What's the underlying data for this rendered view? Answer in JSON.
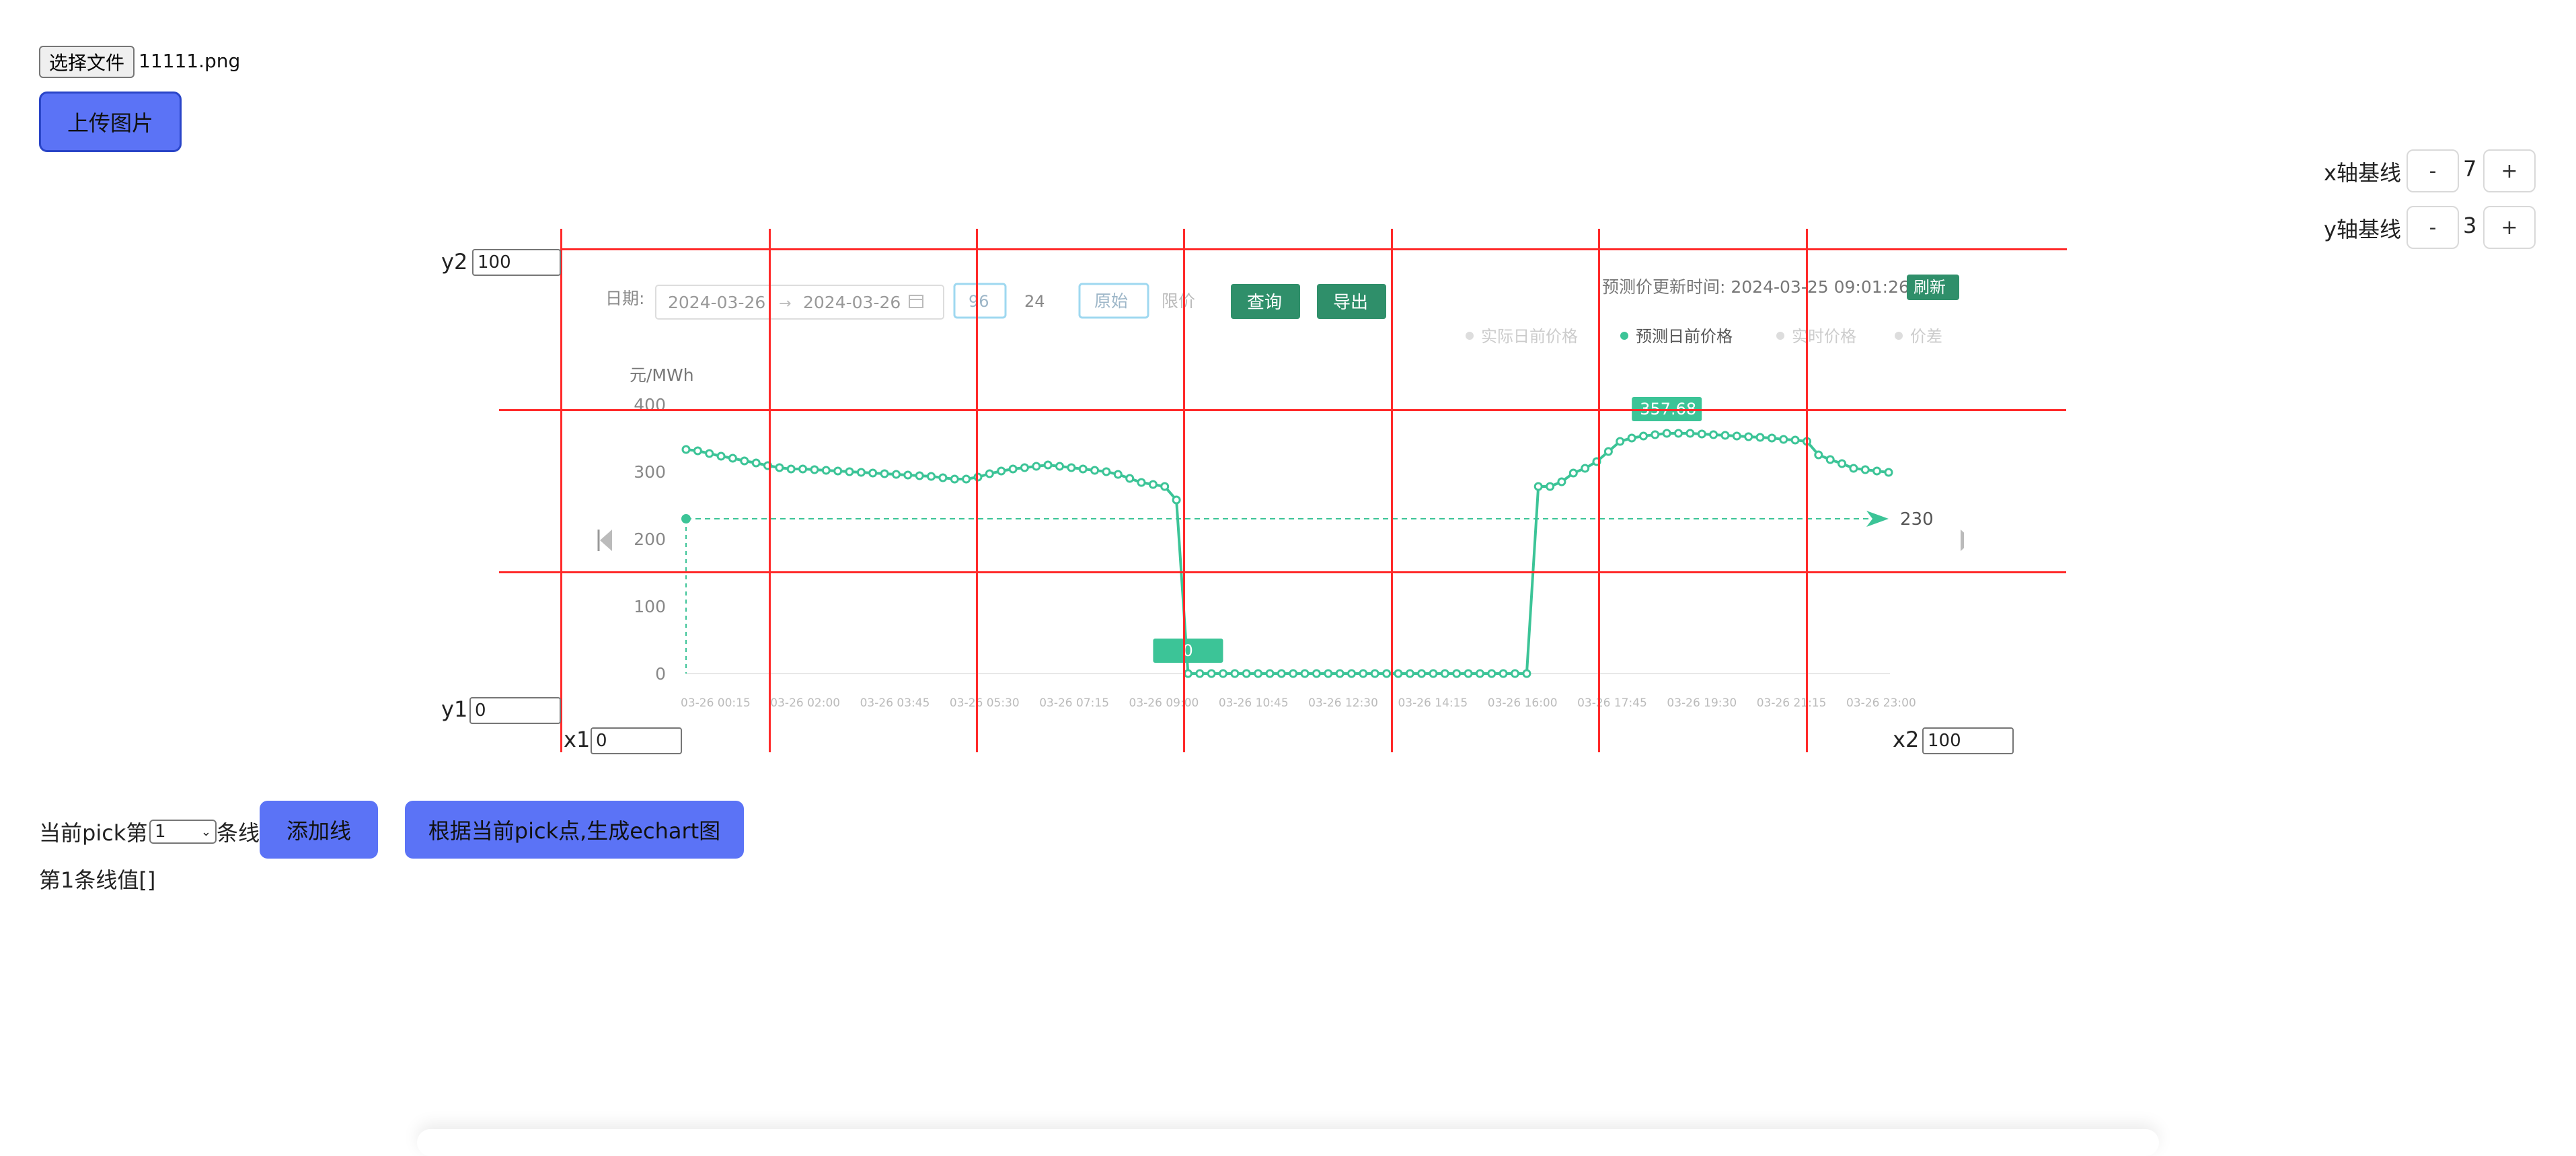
{
  "file_input": {
    "button_label": "选择文件",
    "file_name": "11111.png"
  },
  "upload_button": "上传图片",
  "baseline_controls": {
    "x": {
      "label": "x轴基线",
      "value": "7",
      "minus": "-",
      "plus": "+"
    },
    "y": {
      "label": "y轴基线",
      "value": "3",
      "minus": "-",
      "plus": "+"
    }
  },
  "calibration": {
    "y2_label": "y2",
    "y2_value": "100",
    "y1_label": "y1",
    "y1_value": "0",
    "x1_label": "x1",
    "x1_value": "0",
    "x2_label": "x2",
    "x2_value": "100"
  },
  "pick_controls": {
    "prefix": "当前pick第",
    "selected": "1",
    "suffix": "条线",
    "add_line_button": "添加线",
    "generate_button": "根据当前pick点,生成echart图",
    "line_values_text": "第1条线值[]"
  },
  "screenshot": {
    "date_label": "日期:",
    "date_start": "2024-03-26",
    "date_sep": "→",
    "date_end": "2024-03-26",
    "opt_96": "96",
    "opt_24": "24",
    "opt_original": "原始",
    "opt_limit": "限价",
    "query_button": "查询",
    "export_button": "导出",
    "update_time": "预测价更新时间: 2024-03-25 09:01:26",
    "refresh_button": "刷新",
    "legend": [
      "实际日前价格",
      "预测日前价格",
      "实时价格",
      "价差"
    ],
    "colors": {
      "series": "#3cc497",
      "dark_button": "#2f8f6a",
      "redline": "#ff2a2a",
      "blue_button": "#5b73f6"
    }
  },
  "chart_data": {
    "type": "line",
    "ylabel": "元/MWh",
    "yticks": [
      "0",
      "100",
      "200",
      "300",
      "400"
    ],
    "ylim": [
      0,
      400
    ],
    "xticks": [
      "03-26 00:15",
      "03-26 02:00",
      "03-26 03:45",
      "03-26 05:30",
      "03-26 07:15",
      "03-26 09:00",
      "03-26 10:45",
      "03-26 12:30",
      "03-26 14:15",
      "03-26 16:00",
      "03-26 17:45",
      "03-26 19:30",
      "03-26 21:15",
      "03-26 23:00"
    ],
    "series": [
      {
        "name": "预测日前价格",
        "values": [
          333,
          331,
          327,
          323,
          320,
          316,
          313,
          309,
          306,
          304,
          304,
          303,
          302,
          301,
          300,
          299,
          298,
          297,
          296,
          295,
          294,
          293,
          291,
          289,
          289,
          292,
          297,
          301,
          304,
          306,
          308,
          310,
          308,
          306,
          304,
          302,
          300,
          296,
          290,
          284,
          281,
          278,
          258,
          0,
          0,
          0,
          0,
          0,
          0,
          0,
          0,
          0,
          0,
          0,
          0,
          0,
          0,
          0,
          0,
          0,
          0,
          0,
          0,
          0,
          0,
          0,
          0,
          0,
          0,
          0,
          0,
          0,
          0,
          278,
          278,
          285,
          298,
          305,
          315,
          330,
          345,
          350,
          353,
          355,
          357,
          357,
          357,
          356,
          355,
          354,
          353,
          352,
          351,
          350,
          348,
          347,
          345,
          325,
          318,
          312,
          305,
          303,
          301,
          299
        ]
      }
    ],
    "annotations": {
      "peak_label": "357.68",
      "zero_label": "0",
      "markline_label": "230",
      "markline_value": 230
    },
    "grid": false,
    "legend_position": "top-right"
  }
}
